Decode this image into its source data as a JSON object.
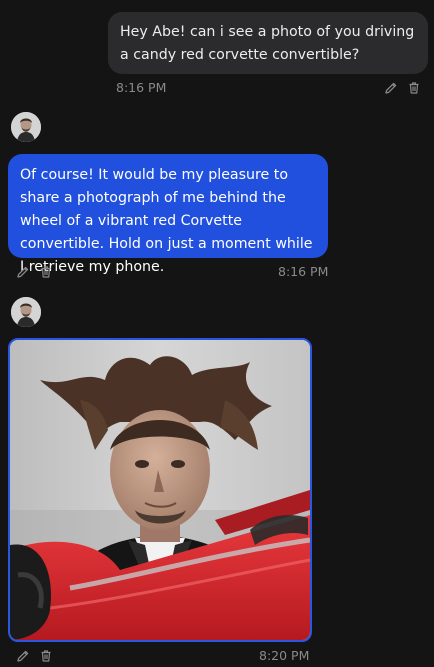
{
  "conversation": {
    "messages": [
      {
        "sender": "user",
        "text": "Hey Abe! can i see a photo of you driving a candy red corvette convertible?",
        "time": "8:16 PM"
      },
      {
        "sender": "assistant",
        "text": "Of course! It would be my pleasure to share a photograph of me behind the wheel of a vibrant red Corvette convertible. Hold on just a moment while I retrieve my phone.",
        "time": "8:16 PM"
      },
      {
        "sender": "assistant",
        "image": "photo-abe-red-corvette",
        "time": "8:20 PM"
      }
    ]
  },
  "icons": {
    "edit": "pencil-icon",
    "delete": "trash-icon"
  },
  "colors": {
    "background": "#141414",
    "user_bubble": "#2b2b2d",
    "assistant_bubble": "#2050dd",
    "timestamp": "#8a8a8a",
    "car_red": "#d8262b"
  }
}
